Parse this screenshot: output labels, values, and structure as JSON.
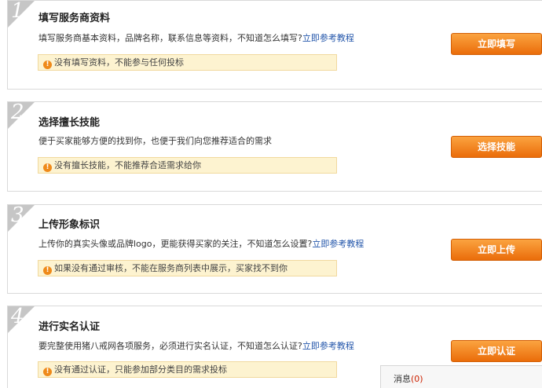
{
  "steps": [
    {
      "num": "1",
      "title": "填写服务商资料",
      "desc": "填写服务商基本资料，品牌名称，联系信息等资料，不知道怎么填写?",
      "link": "立即参考教程",
      "warning": "没有填写资料，不能参与任何投标",
      "button": "立即填写"
    },
    {
      "num": "2",
      "title": "选择擅长技能",
      "desc": "便于买家能够方便的找到你，也便于我们向您推荐适合的需求",
      "link": "",
      "warning": "没有擅长技能，不能推荐合适需求给你",
      "button": "选择技能"
    },
    {
      "num": "3",
      "title": "上传形象标识",
      "desc": "上传你的真实头像或品牌logo，更能获得买家的关注，不知道怎么设置?",
      "link": "立即参考教程",
      "warning": "如果没有通过审核，不能在服务商列表中展示，买家找不到你",
      "button": "立即上传"
    },
    {
      "num": "4",
      "title": "进行实名认证",
      "desc": "要完整使用猪八戒网各项服务，必须进行实名认证，不知道怎么认证?",
      "link": "立即参考教程",
      "warning": "没有通过认证，只能参加部分类目的需求投标",
      "button": "立即认证"
    }
  ],
  "message_bar": {
    "label": "消息",
    "count": "(0)"
  },
  "icons": {
    "warning": "exclamation-circle-icon"
  },
  "colors": {
    "accent": "#ef8a1a",
    "link": "#2255aa",
    "warning_bg": "#fdf3d0",
    "step_badge": "#c6c6c6"
  }
}
